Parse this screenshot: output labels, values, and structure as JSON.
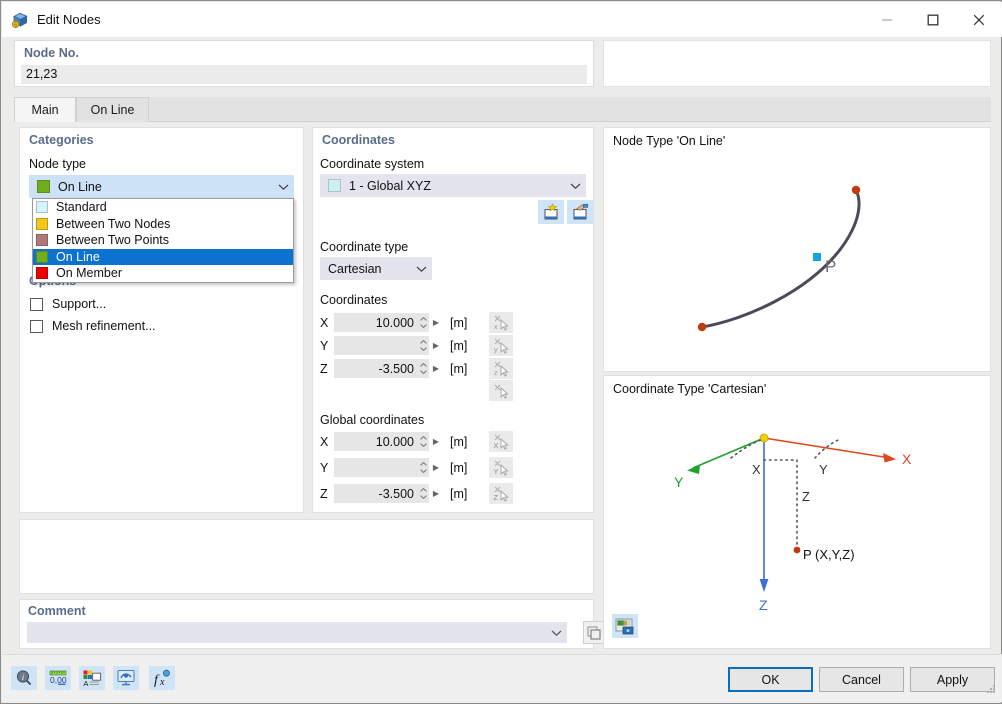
{
  "window": {
    "title": "Edit Nodes",
    "icon": "node-box-icon",
    "minimize_label": "—",
    "maximize_label": "☐",
    "close_label": "✕"
  },
  "node_no": {
    "label": "Node No.",
    "value": "21,23",
    "placeholder": ""
  },
  "tabs": [
    {
      "label": "Main",
      "active": true
    },
    {
      "label": "On Line",
      "active": false
    }
  ],
  "categories": {
    "title": "Categories",
    "node_type_label": "Node type",
    "selected": {
      "label": "On Line",
      "color": "#70ad1f"
    },
    "dropdown_open": true,
    "options": [
      {
        "label": "Standard",
        "color": "#d4f5f7",
        "selected": false
      },
      {
        "label": "Between Two Nodes",
        "color": "#f5c518",
        "selected": false
      },
      {
        "label": "Between Two Points",
        "color": "#b07878",
        "selected": false
      },
      {
        "label": "On Line",
        "color": "#70ad1f",
        "selected": true
      },
      {
        "label": "On Member",
        "color": "#ef0000",
        "selected": false
      }
    ],
    "options_label": "Options",
    "checkboxes": [
      {
        "label": "Support...",
        "checked": false
      },
      {
        "label": "Mesh refinement...",
        "checked": false
      }
    ]
  },
  "coordinates": {
    "title": "Coordinates",
    "coord_system_label": "Coordinate system",
    "coord_system_value": "1 - Global XYZ",
    "coord_system_color": "#cdf0f2",
    "new_cs_button": "new-coordinate-system-icon",
    "edit_cs_button": "edit-coordinate-system-icon",
    "coord_type_label": "Coordinate type",
    "coord_type_value": "Cartesian",
    "local_title": "Coordinates",
    "local_fields": [
      {
        "axis": "X",
        "value": "10.000",
        "unit": "[m]",
        "pick": "pick-x-icon"
      },
      {
        "axis": "Y",
        "value": "",
        "unit": "[m]",
        "pick": "pick-y-icon"
      },
      {
        "axis": "Z",
        "value": "-3.500",
        "unit": "[m]",
        "pick": "pick-z-icon"
      }
    ],
    "extra_pick": "pick-point-icon",
    "global_title": "Global coordinates",
    "global_fields": [
      {
        "axis": "X",
        "value": "10.000",
        "unit": "[m]",
        "pick": "pick-global-x-icon"
      },
      {
        "axis": "Y",
        "value": "",
        "unit": "[m]",
        "pick": "pick-global-y-icon"
      },
      {
        "axis": "Z",
        "value": "-3.500",
        "unit": "[m]",
        "pick": "pick-global-z-icon"
      }
    ]
  },
  "comment": {
    "label": "Comment",
    "value": "",
    "placeholder": "",
    "button": "comment-library-icon"
  },
  "previews": {
    "top": {
      "label": "Node Type 'On Line'",
      "point_label": "P",
      "curve_color": "#4a4a58",
      "end_node_color": "#c0390f",
      "point_color": "#11a6e0"
    },
    "bottom": {
      "label": "Coordinate Type 'Cartesian'",
      "axis_x_label": "X",
      "axis_y_label": "Y",
      "axis_z_label": "Z",
      "proj_x_label": "X",
      "proj_y_label": "Y",
      "proj_z_label": "Z",
      "point_label": "P (X,Y,Z)",
      "axis_x_color": "#e0451b",
      "axis_y_color": "#1fa02f",
      "axis_z_color": "#3b6fd6",
      "origin_color": "#f5d000",
      "point_color": "#c0390f"
    },
    "image_button": "preview-image-icon"
  },
  "toolbar": [
    {
      "name": "info-icon"
    },
    {
      "name": "units-decimal-icon"
    },
    {
      "name": "display-properties-icon"
    },
    {
      "name": "visual-settings-icon"
    },
    {
      "name": "formula-icon"
    }
  ],
  "dialog_buttons": [
    {
      "label": "OK",
      "primary": true
    },
    {
      "label": "Cancel",
      "primary": false
    },
    {
      "label": "Apply",
      "primary": false
    }
  ]
}
